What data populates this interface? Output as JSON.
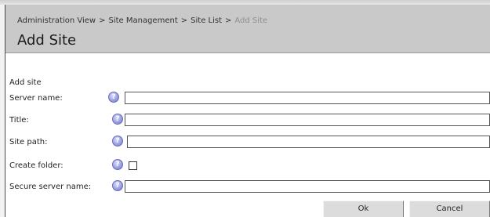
{
  "breadcrumb": {
    "items": [
      "Administration View",
      "Site Management",
      "Site List"
    ],
    "current": "Add Site",
    "separator": ">"
  },
  "page": {
    "title": "Add Site"
  },
  "form": {
    "section_label": "Add site",
    "help_glyph": "?",
    "fields": [
      {
        "label": "Server name:",
        "value": "",
        "type": "text"
      },
      {
        "label": "Title:",
        "value": "",
        "type": "text"
      },
      {
        "label": "Site path:",
        "value": "",
        "type": "text"
      },
      {
        "label": "Create folder:",
        "checked": false,
        "type": "checkbox"
      },
      {
        "label": "Secure server name:",
        "value": "",
        "type": "text"
      }
    ]
  },
  "buttons": {
    "ok": "Ok",
    "cancel": "Cancel"
  },
  "colors": {
    "header_bg": "#c9c9c9",
    "current_crumb": "#8e8e8e",
    "help_icon": "#8c92d8",
    "button_bg": "#dcdcdc"
  },
  "icons": {
    "help": "help-icon"
  }
}
